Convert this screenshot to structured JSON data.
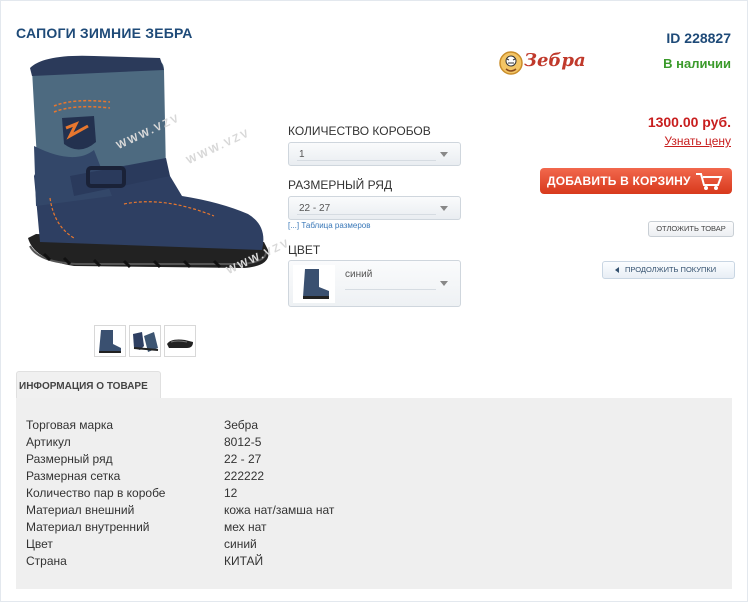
{
  "product": {
    "title": "САПОГИ ЗИМНИЕ ЗЕБРА",
    "id_label": "ID 228827",
    "stock": "В наличии",
    "brand": "Зебра",
    "price": "1300.00 руб.",
    "price_link": "Узнать цену",
    "watermark": "WWW.VZV"
  },
  "options": {
    "boxes_label": "КОЛИЧЕСТВО КОРОБОВ",
    "boxes_value": "1",
    "size_label": "РАЗМЕРНЫЙ РЯД",
    "size_value": "22 - 27",
    "size_table_link": "[...] Таблица размеров",
    "color_label": "ЦВЕТ",
    "color_value": "синий"
  },
  "buttons": {
    "add_to_cart": "ДОБАВИТЬ В КОРЗИНУ",
    "defer": "ОТЛОЖИТЬ ТОВАР",
    "continue": "ПРОДОЛЖИТЬ ПОКУПКИ"
  },
  "info": {
    "tab_label": "ИНФОРМАЦИЯ О ТОВАРЕ",
    "rows": [
      {
        "label": "Торговая марка",
        "value": "Зебра"
      },
      {
        "label": "Артикул",
        "value": "8012-5"
      },
      {
        "label": "Размерный ряд",
        "value": "22 - 27"
      },
      {
        "label": "Размерная сетка",
        "value": "222222"
      },
      {
        "label": "Количество пар в коробе",
        "value": "12"
      },
      {
        "label": "Материал внешний",
        "value": "кожа нат/замша нат"
      },
      {
        "label": "Материал внутренний",
        "value": "мех нат"
      },
      {
        "label": "Цвет",
        "value": "синий"
      },
      {
        "label": "Страна",
        "value": "КИТАЙ"
      }
    ]
  },
  "colors": {
    "title": "#1e4a78",
    "stock": "#3a9a2a",
    "price": "#c81e1e",
    "cart_button": "#e0452a",
    "boot_leather": "#2e3f62",
    "boot_suede": "#4d6a80"
  }
}
